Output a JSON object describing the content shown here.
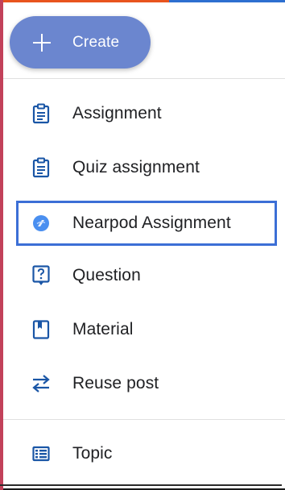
{
  "create_button": {
    "label": "Create",
    "icon": "plus-icon"
  },
  "menu": {
    "items": [
      {
        "label": "Assignment",
        "icon": "assignment-icon"
      },
      {
        "label": "Quiz assignment",
        "icon": "quiz-assignment-icon"
      },
      {
        "label": "Nearpod Assignment",
        "icon": "nearpod-icon",
        "highlighted": true
      },
      {
        "label": "Question",
        "icon": "question-icon"
      },
      {
        "label": "Material",
        "icon": "material-icon"
      },
      {
        "label": "Reuse post",
        "icon": "reuse-post-icon"
      },
      {
        "label": "Topic",
        "icon": "topic-icon"
      }
    ]
  },
  "colors": {
    "accent": "#3c6fd6",
    "create_button": "#6b86cf",
    "icon": "#1a56a6",
    "nearpod": "#4a8ff0"
  }
}
